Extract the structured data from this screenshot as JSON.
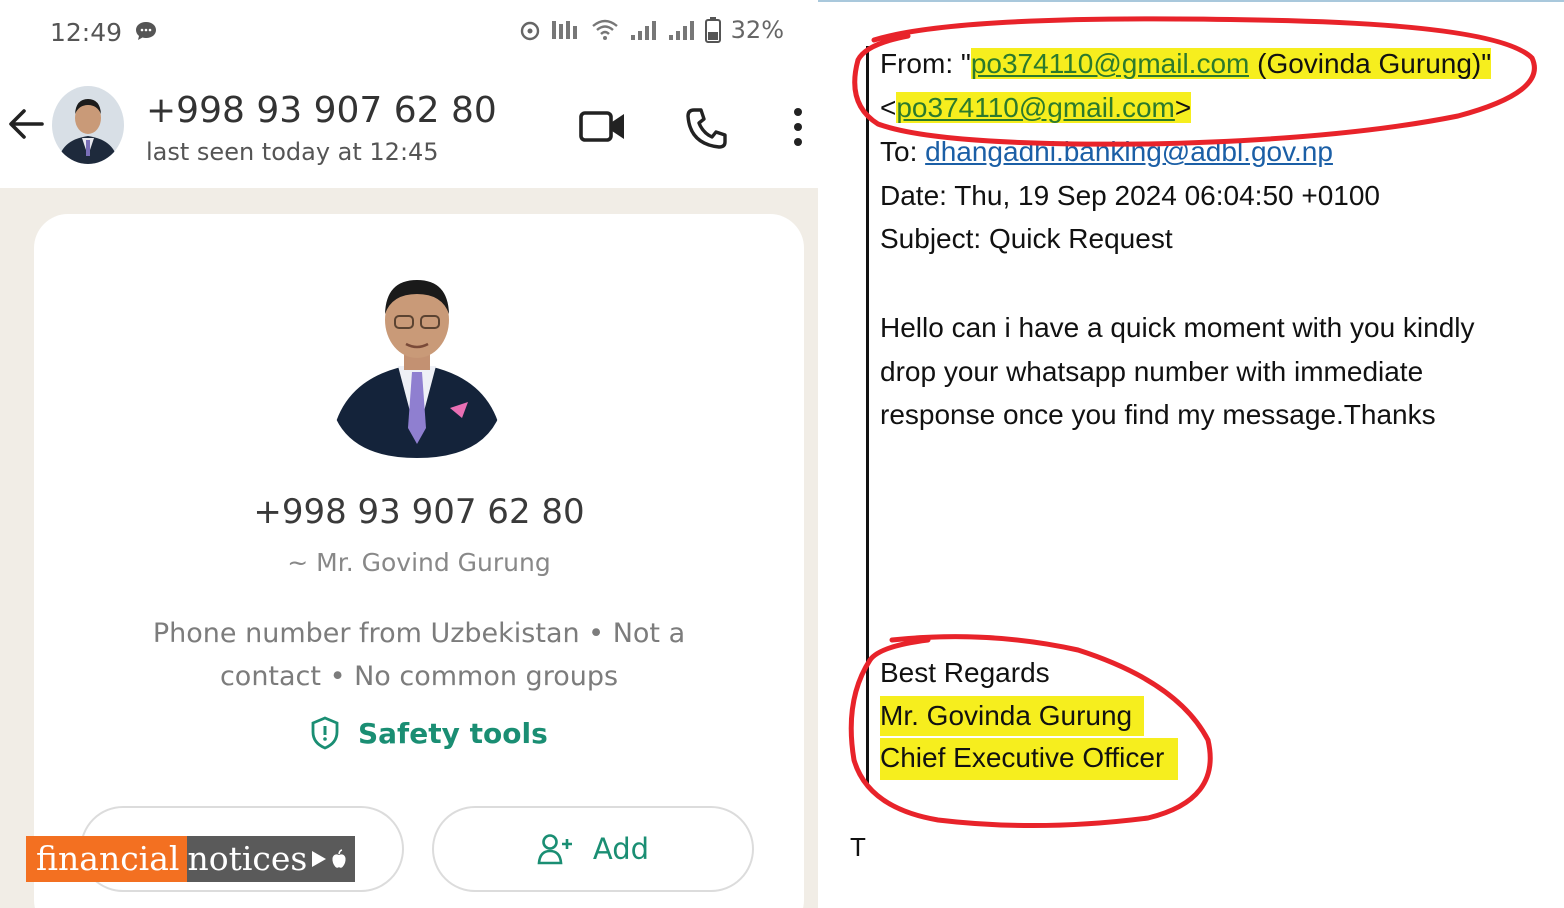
{
  "whatsapp": {
    "status_bar": {
      "time": "12:49",
      "battery": "32%",
      "icons": [
        "chat-bubble-icon",
        "alarm-icon",
        "volte-icon",
        "wifi-icon",
        "signal-icon",
        "signal-icon",
        "battery-icon"
      ]
    },
    "header": {
      "contact_number": "+998 93 907 62 80",
      "last_seen": "last seen today at 12:45",
      "icons": [
        "back-arrow-icon",
        "video-call-icon",
        "phone-call-icon",
        "more-options-icon"
      ]
    },
    "profile": {
      "phone": "+998 93 907 62 80",
      "name": "~ Mr. Govind Gurung",
      "info_line1": "Phone number from Uzbekistan • Not a",
      "info_line2": "contact • No common groups",
      "safety_tools": "Safety tools",
      "add_label": "Add"
    },
    "colors": {
      "accent": "#1a8e73",
      "chat_bg": "#f1ede6"
    }
  },
  "watermark": {
    "part1": "financial",
    "part2": "notices",
    "colors": {
      "orange": "#f37021",
      "grey": "#5a5a5a"
    }
  },
  "email": {
    "from_label": "From: \"",
    "from_email": "po374110@gmail.com",
    "from_name": " (Govinda Gurung)\"",
    "from_lt": "<",
    "from_email2": "po374110@gmail.com",
    "from_gt": ">",
    "to_label": "To: ",
    "to_email": "dhangadhi.banking@adbl.gov.np",
    "date": "Date: Thu, 19 Sep 2024 06:04:50 +0100",
    "subject": "Subject: Quick Request",
    "body": "Hello can i have a quick moment with you kindly drop your whatsapp number with immediate response once you find my message.Thanks",
    "regards": "Best Regards",
    "signature_name": "Mr. Govinda Gurung",
    "signature_title": "Chief Executive Officer",
    "trailing": "T",
    "colors": {
      "highlight": "#f6ee1e",
      "annotation": "#e8232a",
      "link": "#1b5fa6"
    }
  }
}
